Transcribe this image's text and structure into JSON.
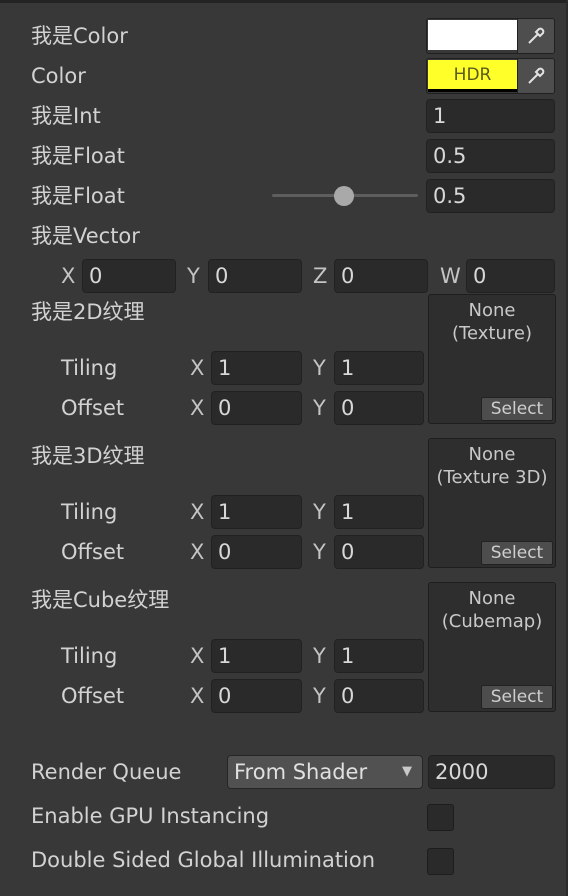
{
  "properties": {
    "color1": {
      "label": "我是Color",
      "swatch": "#ffffff"
    },
    "color2": {
      "label": "Color",
      "swatch": "#ffff2a",
      "hdr_text": "HDR"
    },
    "int": {
      "label": "我是Int",
      "value": "1"
    },
    "float1": {
      "label": "我是Float",
      "value": "0.5"
    },
    "float2": {
      "label": "我是Float",
      "value": "0.5",
      "slider_fraction": 0.5
    },
    "vector": {
      "label": "我是Vector",
      "axes": [
        "X",
        "Y",
        "Z",
        "W"
      ],
      "values": [
        "0",
        "0",
        "0",
        "0"
      ]
    }
  },
  "textures": [
    {
      "label": "我是2D纹理",
      "preview_line1": "None",
      "preview_line2": "(Texture)",
      "select": "Select",
      "tiling_label": "Tiling",
      "offset_label": "Offset",
      "tiling": {
        "x_axis": "X",
        "x": "1",
        "y_axis": "Y",
        "y": "1"
      },
      "offset": {
        "x_axis": "X",
        "x": "0",
        "y_axis": "Y",
        "y": "0"
      }
    },
    {
      "label": "我是3D纹理",
      "preview_line1": "None",
      "preview_line2": "(Texture 3D)",
      "select": "Select",
      "tiling_label": "Tiling",
      "offset_label": "Offset",
      "tiling": {
        "x_axis": "X",
        "x": "1",
        "y_axis": "Y",
        "y": "1"
      },
      "offset": {
        "x_axis": "X",
        "x": "0",
        "y_axis": "Y",
        "y": "0"
      }
    },
    {
      "label": "我是Cube纹理",
      "preview_line1": "None",
      "preview_line2": "(Cubemap)",
      "select": "Select",
      "tiling_label": "Tiling",
      "offset_label": "Offset",
      "tiling": {
        "x_axis": "X",
        "x": "1",
        "y_axis": "Y",
        "y": "1"
      },
      "offset": {
        "x_axis": "X",
        "x": "0",
        "y_axis": "Y",
        "y": "0"
      }
    }
  ],
  "settings": {
    "render_queue_label": "Render Queue",
    "render_queue_mode": "From Shader",
    "render_queue_value": "2000",
    "gpu_instancing_label": "Enable GPU Instancing",
    "gpu_instancing_checked": false,
    "double_sided_gi_label": "Double Sided Global Illumination",
    "double_sided_gi_checked": false
  },
  "icons": {
    "picker": "eyedropper-icon",
    "dropdown": "triangle-down-icon"
  }
}
